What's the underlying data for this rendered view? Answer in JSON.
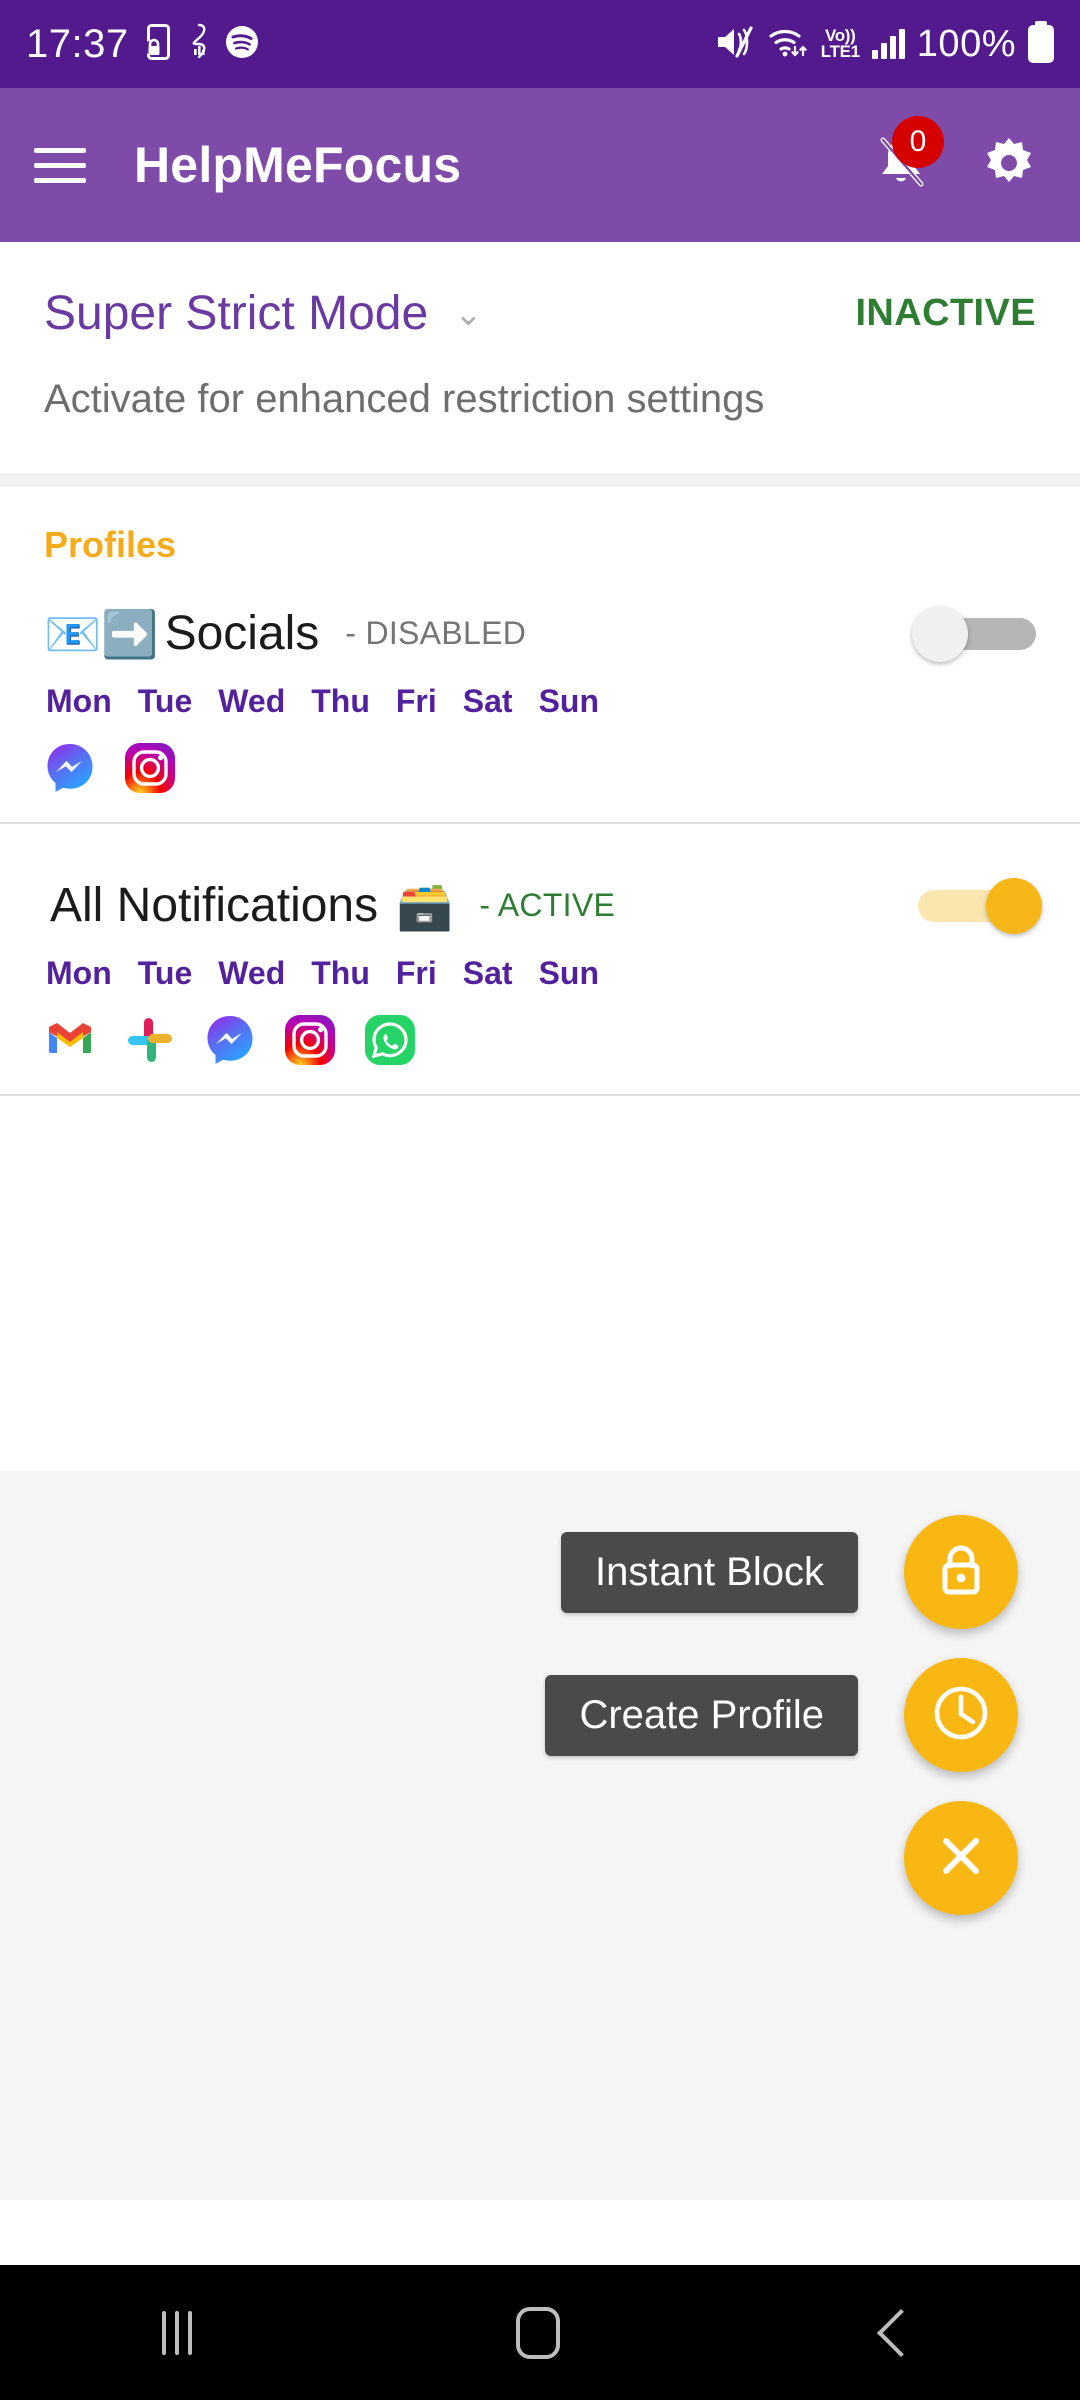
{
  "status_bar": {
    "clock": "17:37",
    "battery_percent": "100%",
    "network_label_top": "Vo))",
    "network_label_bottom": "LTE1",
    "icons": [
      "lock-phone-icon",
      "hourglass-stats-icon",
      "spotify-icon",
      "mute-icon",
      "wifi-icon",
      "volte-icon",
      "signal-bars-icon",
      "battery-icon"
    ]
  },
  "app_bar": {
    "menu_icon": "hamburger-menu-icon",
    "title": "HelpMeFocus",
    "notification_badge": "0",
    "bell_icon": "bell-off-icon",
    "settings_icon": "gear-icon"
  },
  "super_strict": {
    "title": "Super Strict Mode",
    "expand_icon": "chevron-down-icon",
    "status": "INACTIVE",
    "status_color": "#2E7D32",
    "subtitle": "Activate for enhanced restriction settings"
  },
  "profiles_section": {
    "header": "Profiles",
    "header_color": "#F5AB1B",
    "items": [
      {
        "emoji": "📧➡️",
        "name": "Socials",
        "status": "- DISABLED",
        "status_color": "#757575",
        "enabled": false,
        "days": [
          "Mon",
          "Tue",
          "Wed",
          "Thu",
          "Fri",
          "Sat",
          "Sun"
        ],
        "apps": [
          "messenger",
          "instagram"
        ]
      },
      {
        "emoji": "🗃️",
        "name": "All Notifications",
        "status": "- ACTIVE",
        "status_color": "#2E7D32",
        "enabled": true,
        "days": [
          "Mon",
          "Tue",
          "Wed",
          "Thu",
          "Fri",
          "Sat",
          "Sun"
        ],
        "apps": [
          "gmail",
          "slack",
          "messenger",
          "instagram",
          "whatsapp"
        ]
      }
    ]
  },
  "fab_menu": {
    "accent_color": "#F9B713",
    "actions": [
      {
        "label": "Instant Block",
        "icon": "lock-icon"
      },
      {
        "label": "Create Profile",
        "icon": "clock-icon"
      }
    ],
    "close": {
      "label": "",
      "icon": "close-icon"
    }
  },
  "nav_bar": {
    "recents": "recents-icon",
    "home": "home-icon",
    "back": "back-icon"
  }
}
